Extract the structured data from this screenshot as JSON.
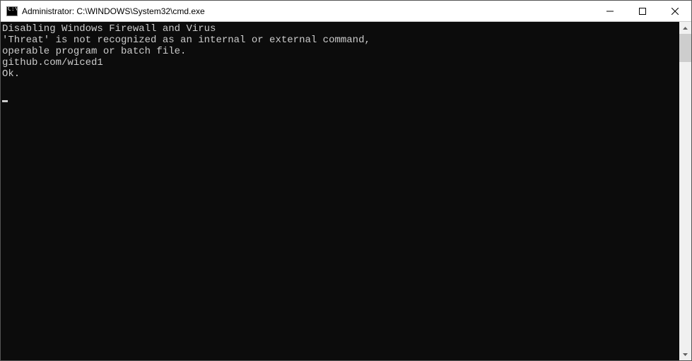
{
  "titlebar": {
    "title": "Administrator: C:\\WINDOWS\\System32\\cmd.exe",
    "icon_label": "C:\\"
  },
  "console": {
    "lines": [
      "Disabling Windows Firewall and Virus",
      "'Threat' is not recognized as an internal or external command,",
      "operable program or batch file.",
      "github.com/wiced1",
      "Ok."
    ]
  }
}
